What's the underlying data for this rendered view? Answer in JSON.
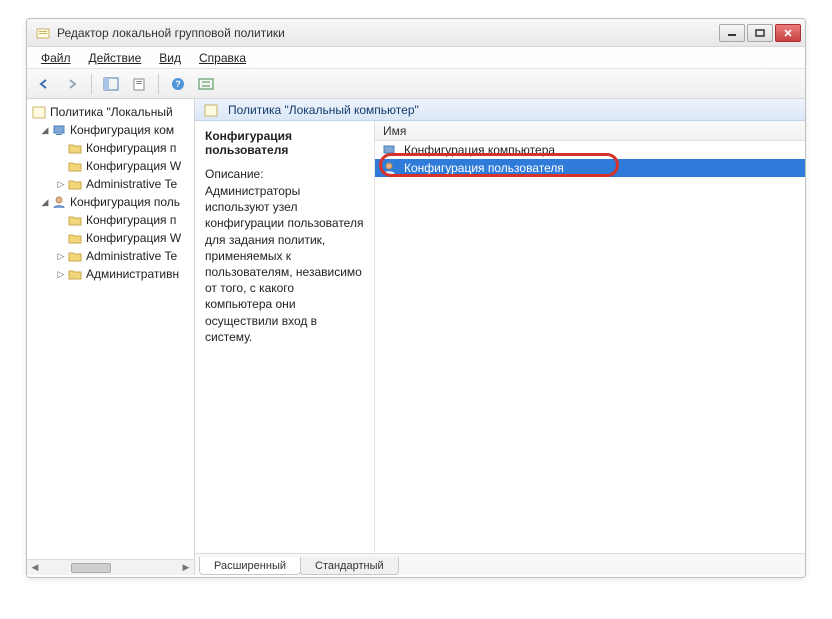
{
  "window": {
    "title": "Редактор локальной групповой политики"
  },
  "menu": {
    "file": "Файл",
    "action": "Действие",
    "view": "Вид",
    "help": "Справка"
  },
  "tree": {
    "root": "Политика \"Локальный",
    "comp_cfg": "Конфигурация ком",
    "soft1": "Конфигурация п",
    "win1": "Конфигурация W",
    "admin1": "Administrative Te",
    "user_cfg": "Конфигурация поль",
    "soft2": "Конфигурация п",
    "win2": "Конфигурация W",
    "admin2": "Administrative Te",
    "admin_ru": "Административн"
  },
  "header": {
    "path": "Политика \"Локальный компьютер\""
  },
  "desc": {
    "heading": "Конфигурация пользователя",
    "label": "Описание:",
    "body": "Администраторы используют узел конфигурации пользователя для задания политик, применяемых к пользователям, независимо от того, с какого компьютера они осуществили вход в систему."
  },
  "list": {
    "col_name": "Имя",
    "items": [
      {
        "label": "Конфигурация компьютера",
        "selected": false,
        "icon": "computer"
      },
      {
        "label": "Конфигурация пользователя",
        "selected": true,
        "icon": "user"
      }
    ]
  },
  "tabs": {
    "extended": "Расширенный",
    "standard": "Стандартный"
  }
}
